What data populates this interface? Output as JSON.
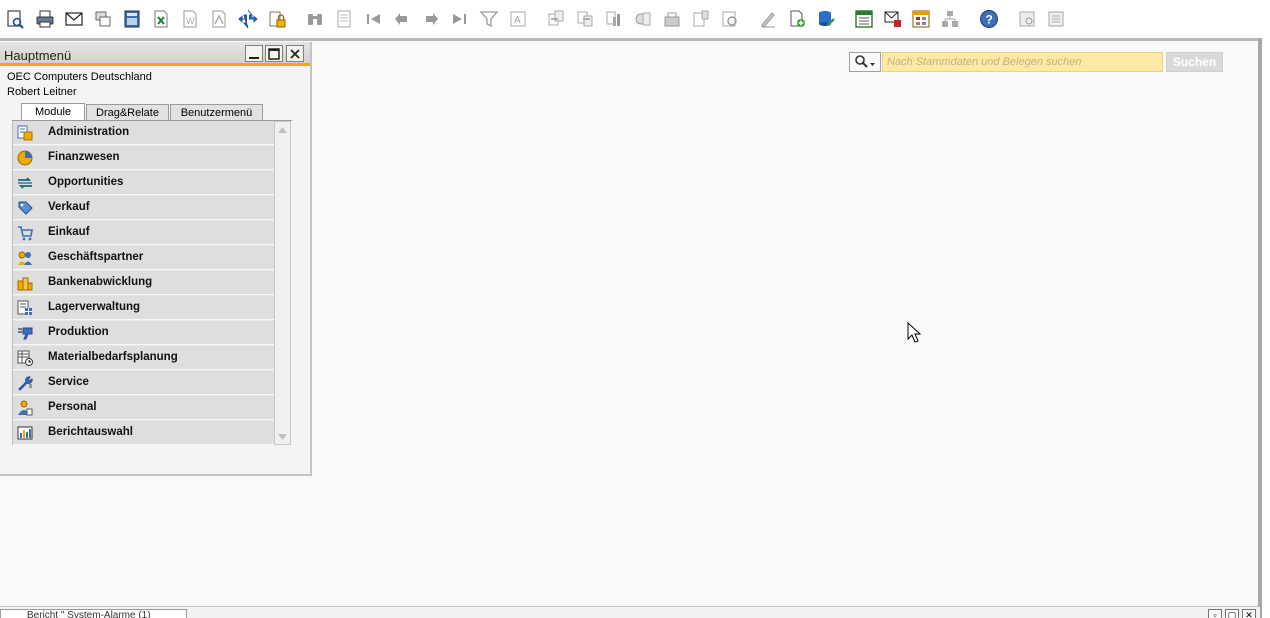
{
  "toolbar": {
    "icons": [
      "print-preview-icon",
      "print-icon",
      "email-icon",
      "send-icon",
      "calculator-icon",
      "excel-export-icon",
      "word-export-icon",
      "pdf-export-icon",
      "navigate-icon",
      "lock-icon",
      "find-icon",
      "add-icon",
      "first-record-icon",
      "previous-record-icon",
      "next-record-icon",
      "last-record-icon",
      "filter-icon",
      "sort-icon",
      "base-document-icon",
      "target-document-icon",
      "gross-profit-icon",
      "payment-means-icon",
      "volume-weight-icon",
      "journal-icon",
      "transaction-journal-icon",
      "settings-icon",
      "add-document-icon",
      "database-tools-icon",
      "calendar-icon",
      "messages-icon",
      "alerts-icon",
      "structure-icon",
      "help-icon",
      "window-list-icon",
      "window-settings-icon"
    ]
  },
  "hauptmenu": {
    "title": "Hauptmenü",
    "company": "OEC Computers Deutschland",
    "user": "Robert Leitner",
    "tabs": [
      {
        "label": "Module",
        "active": true
      },
      {
        "label": "Drag&Relate",
        "active": false
      },
      {
        "label": "Benutzermenü",
        "active": false
      }
    ],
    "modules": [
      {
        "label": "Administration",
        "icon": "administration-icon"
      },
      {
        "label": "Finanzwesen",
        "icon": "finance-pie-icon"
      },
      {
        "label": "Opportunities",
        "icon": "opportunities-icon"
      },
      {
        "label": "Verkauf",
        "icon": "sales-tag-icon"
      },
      {
        "label": "Einkauf",
        "icon": "shopping-cart-icon"
      },
      {
        "label": "Geschäftspartner",
        "icon": "business-partners-icon"
      },
      {
        "label": "Bankenabwicklung",
        "icon": "banking-icon"
      },
      {
        "label": "Lagerverwaltung",
        "icon": "inventory-icon"
      },
      {
        "label": "Produktion",
        "icon": "production-icon"
      },
      {
        "label": "Materialbedarfsplanung",
        "icon": "mrp-icon"
      },
      {
        "label": "Service",
        "icon": "service-wrench-icon"
      },
      {
        "label": "Personal",
        "icon": "personnel-icon"
      },
      {
        "label": "Berichtauswahl",
        "icon": "reports-icon"
      }
    ]
  },
  "search": {
    "placeholder": "Nach Stammdaten und Belegen suchen",
    "button_label": "Suchen"
  },
  "taskbar": {
    "window_label": "Bericht \" System-Alarme (1)"
  },
  "colors": {
    "accent": "#f0ab00",
    "search_bg": "#fbe9a5"
  }
}
